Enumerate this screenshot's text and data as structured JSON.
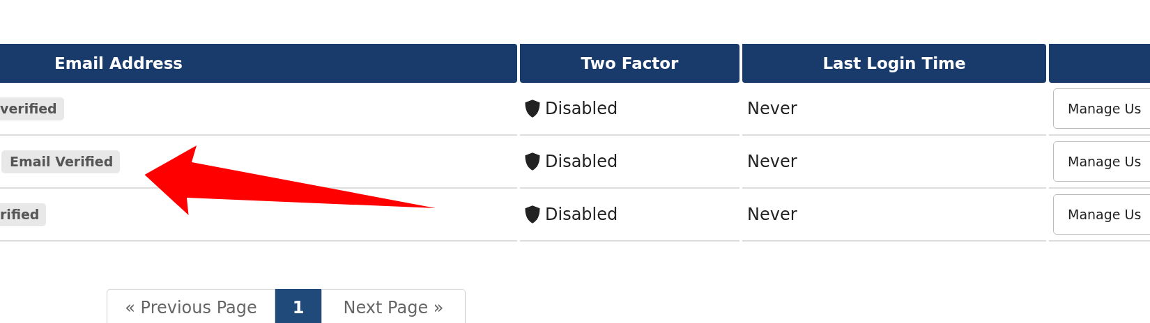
{
  "table": {
    "columns": [
      "Email Address",
      "Two Factor",
      "Last Login Time"
    ],
    "rows": [
      {
        "email_badge": "verified",
        "two_factor": "Disabled",
        "last_login": "Never",
        "action": "Manage Us"
      },
      {
        "email_badge": "Email Verified",
        "two_factor": "Disabled",
        "last_login": "Never",
        "action": "Manage Us"
      },
      {
        "email_badge": "rified",
        "two_factor": "Disabled",
        "last_login": "Never",
        "action": "Manage Us"
      }
    ]
  },
  "annotation": {
    "kind": "arrow"
  },
  "pagination": {
    "previous": "« Previous Page",
    "pages": [
      {
        "label": "1",
        "selected": true
      }
    ],
    "next": "Next Page »"
  }
}
